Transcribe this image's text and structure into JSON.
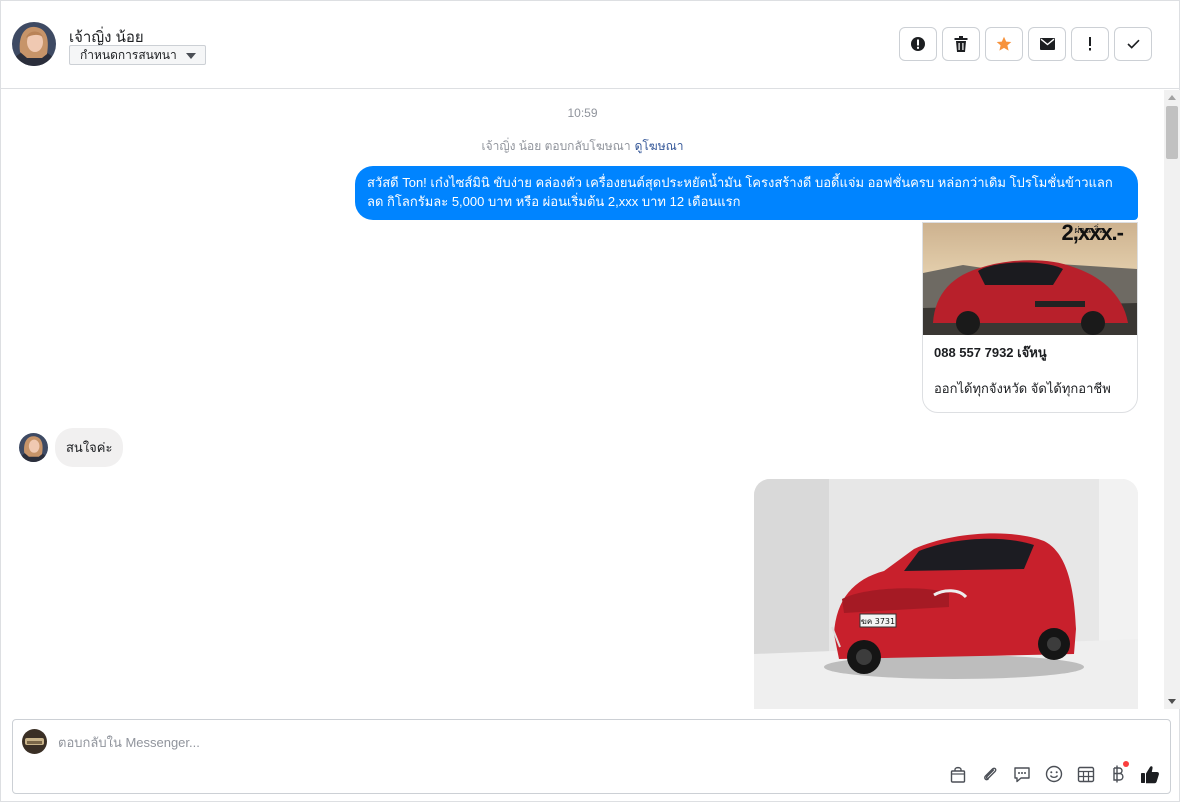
{
  "header": {
    "contact_name": "เจ้าญิ่ง น้อย",
    "label_dropdown": "กำหนดการสนทนา",
    "actions": [
      {
        "name": "mark-spam",
        "icon": "alert-circle-icon"
      },
      {
        "name": "delete",
        "icon": "trash-icon"
      },
      {
        "name": "star",
        "icon": "star-icon",
        "color": "#f7923b"
      },
      {
        "name": "mark-unread",
        "icon": "envelope-icon"
      },
      {
        "name": "follow-up",
        "icon": "exclamation-icon"
      },
      {
        "name": "mark-done",
        "icon": "check-icon"
      }
    ]
  },
  "thread": {
    "timestamp": "10:59",
    "reply_note": "เจ้าญิ่ง น้อย ตอบกลับโฆษณา",
    "reply_note_link": "ดูโฆษณา",
    "outgoing_message": "สวัสดี Ton! เก๋งไซส์มินิ ขับง่าย คล่องตัว เครื่องยนต์สุดประหยัดน้ำมัน โครงสร้างดี บอดี้แจ่ม ออฟชั่นครบ หล่อกว่าเดิม โปรโมชั่นข้าวแลก ลด กิโลกรัมละ 5,000 บาท หรือ ผ่อนเริ่มต้น 2,xxx บาท 12 เดือนแรก",
    "ad_card": {
      "image_overlay_text": "2,xxx.-",
      "image_overlay_small": "ผ่อนเริ่ม",
      "title": "088 557 7932 เจ๊หนู",
      "subtitle": "ออกได้ทุกจังหวัด จัดได้ทุกอาชีพ"
    },
    "incoming_message": "สนใจค่ะ",
    "photo": {
      "plate_text": "ฆค 3731"
    }
  },
  "composer": {
    "placeholder": "ตอบกลับใน Messenger...",
    "tools": [
      "shopping-bag-icon",
      "paperclip-icon",
      "saved-reply-icon",
      "emoji-icon",
      "appointment-icon",
      "baht-icon",
      "thumbs-up-icon"
    ]
  },
  "colors": {
    "accent": "#0084ff",
    "star": "#f7923b",
    "incoming_bubble": "#f1f0f0",
    "link": "#365899"
  }
}
